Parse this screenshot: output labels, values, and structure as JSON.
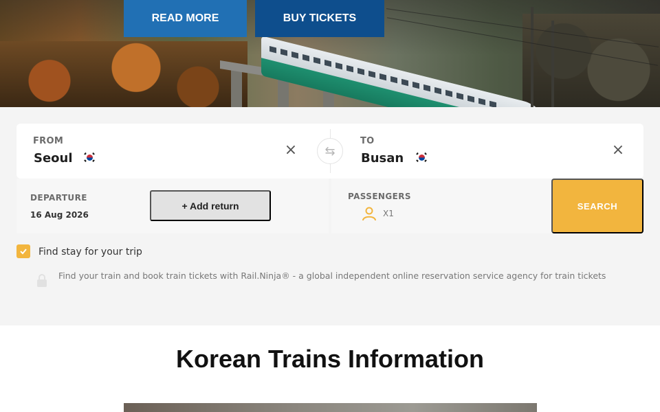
{
  "hero": {
    "read_more_label": "READ MORE",
    "buy_tickets_label": "BUY TICKETS"
  },
  "search": {
    "from_label": "FROM",
    "from_city": "Seoul",
    "to_label": "TO",
    "to_city": "Busan",
    "flag_icon": "south-korea-flag-icon",
    "clear_icon": "close-icon",
    "swap_icon": "swap-arrows-icon",
    "departure_label": "DEPARTURE",
    "departure_date": "16 Aug 2026",
    "add_return_label": "+ Add return",
    "passengers_label": "PASSENGERS",
    "passenger_icon": "person-icon",
    "passenger_count": "X1",
    "search_label": "SEARCH",
    "accent_color": "#f2b53e"
  },
  "stay": {
    "checked": true,
    "label": "Find stay for your trip"
  },
  "notice": {
    "icon": "lock-icon",
    "text": "Find your train and book train tickets with Rail.Ninja® - a global independent online reservation service agency for train tickets"
  },
  "info": {
    "title": "Korean Trains Information"
  },
  "colors": {
    "read_more": "#2170b4",
    "buy_tickets": "#0e4e8d"
  }
}
